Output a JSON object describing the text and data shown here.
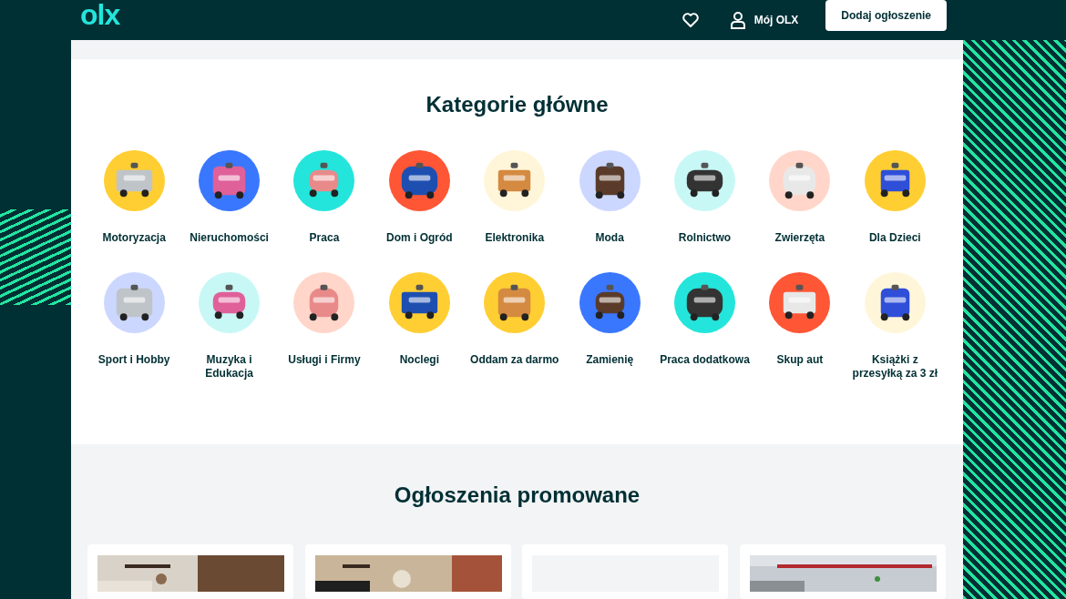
{
  "header": {
    "logo": "olx",
    "account_label": "Mój OLX",
    "post_button": "Dodaj ogłoszenie"
  },
  "categories": {
    "title": "Kategorie główne",
    "items": [
      {
        "label": "Motoryzacja"
      },
      {
        "label": "Nieruchomości"
      },
      {
        "label": "Praca"
      },
      {
        "label": "Dom i Ogród"
      },
      {
        "label": "Elektronika"
      },
      {
        "label": "Moda"
      },
      {
        "label": "Rolnictwo"
      },
      {
        "label": "Zwierzęta"
      },
      {
        "label": "Dla Dzieci"
      },
      {
        "label": "Sport i Hobby"
      },
      {
        "label": "Muzyka i Edukacja"
      },
      {
        "label": "Usługi i Firmy"
      },
      {
        "label": "Noclegi"
      },
      {
        "label": "Oddam za darmo"
      },
      {
        "label": "Zamienię"
      },
      {
        "label": "Praca dodatkowa"
      },
      {
        "label": "Skup aut"
      },
      {
        "label": "Książki z przesyłką za 3 zł"
      }
    ]
  },
  "promoted": {
    "title": "Ogłoszenia promowane",
    "cards": [
      {
        "kind": "picture"
      },
      {
        "kind": "picture"
      },
      {
        "kind": "blank"
      },
      {
        "kind": "picture"
      }
    ]
  }
}
